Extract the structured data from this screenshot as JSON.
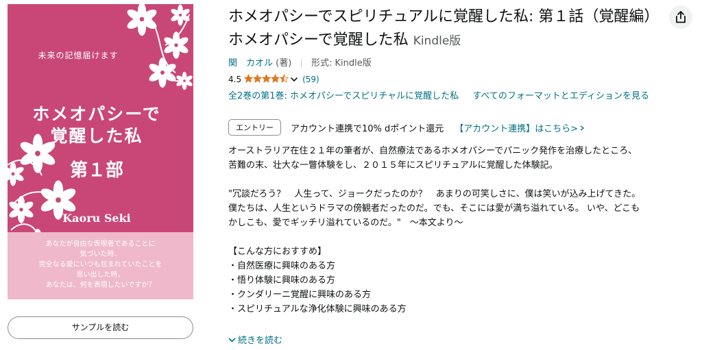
{
  "cover": {
    "tagline": "未来の記憶届けます",
    "title_line1": "ホメオパシーで",
    "title_line2": "覚醒した私",
    "volume": "第１部",
    "author": "Kaoru Seki",
    "quote": [
      "あなたが自由な表現者であることに",
      "気づいた時、",
      "完全なる愛にいつも包まれていたことを",
      "思い出した時、",
      "あなたは、何を表現したいですか？"
    ],
    "colors": {
      "background": "#c94777",
      "band": "#efb8cb",
      "flower": "#ffffff"
    }
  },
  "sample_button": "サンプルを読む",
  "product": {
    "title": "ホメオパシーでスピリチュアルに覚醒した私: 第１話（覚醒編） ホメオパシーで覚醒した私",
    "format_suffix": "Kindle版",
    "author_name": "関　カオル",
    "author_role": "(著)",
    "format_label": "形式: Kindle版",
    "rating_value": "4.5",
    "rating_count": "(59)",
    "rating_stars": 4.5,
    "series_link": "全2巻の第1巻: ホメオパシーでスピリチャルに覚醒した私",
    "formats_link": "すべてのフォーマットとエディションを見る"
  },
  "promo": {
    "badge": "エントリー",
    "text": "アカウント連携で10% dポイント還元",
    "link": "【アカウント連携】はこちら>"
  },
  "description": {
    "para1": [
      "オーストラリア在住２１年の筆者が、自然療法であるホメオパシーでパニック発作を治療したところ、",
      "苦難の末、壮大な一瞥体験をし、２０１５年にスピリチュアルに覚醒した体験記。"
    ],
    "para2": [
      "\"冗談だろう？　人生って、ジョークだったのか？　あまりの可笑しさに、僕は笑いが込み上げてきた。",
      "僕たちは、人生というドラマの傍観者だったのだ。でも、そこには愛が満ち溢れている。 いや、どこも",
      "かしこも、愛でギッチリ溢れているのだ。\"　～本文より～"
    ],
    "list_heading": "【こんな方におすすめ】",
    "list": [
      "・自然医療に興味のある方",
      "・悟り体験に興味のある方",
      "・クンダリーニ覚醒に興味のある方",
      "・スピリチュアルな浄化体験に興味のある方"
    ]
  },
  "read_more": "続きを読む",
  "colors": {
    "link": "#007185",
    "star": "#de7921",
    "text": "#0f1111",
    "muted": "#565959"
  }
}
